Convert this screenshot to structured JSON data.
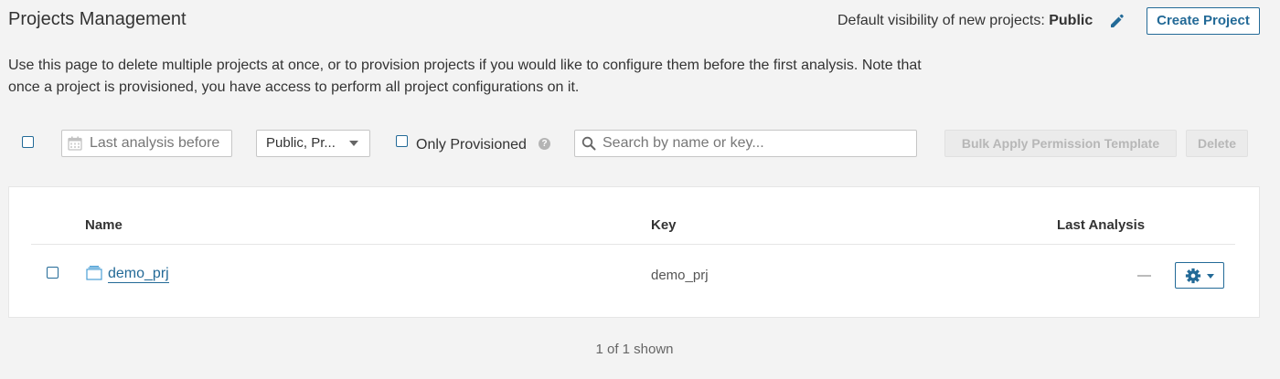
{
  "header": {
    "title": "Projects Management",
    "visibility_label": "Default visibility of new projects:",
    "visibility_value": "Public",
    "create_button": "Create Project"
  },
  "description": "Use this page to delete multiple projects at once, or to provision projects if you would like to configure them before the first analysis. Note that once a project is provisioned, you have access to perform all project configurations on it.",
  "filters": {
    "date_placeholder": "Last analysis before",
    "visibility_select": "Public, Pr...",
    "only_provisioned_label": "Only Provisioned",
    "only_provisioned_checked": false,
    "help_symbol": "?",
    "search_placeholder": "Search by name or key...",
    "bulk_apply_button": "Bulk Apply Permission Template",
    "delete_button": "Delete"
  },
  "table": {
    "columns": [
      "Name",
      "Key",
      "Last Analysis"
    ],
    "rows": [
      {
        "name": "demo_prj",
        "key": "demo_prj",
        "last_analysis": "—",
        "selected": false
      }
    ]
  },
  "footer": {
    "shown_text": "1 of 1 shown"
  },
  "colors": {
    "accent": "#236a97",
    "background": "#f3f3f3",
    "panel": "#ffffff",
    "disabled_text": "#b7b7b7"
  },
  "icons": {
    "edit": "pencil-icon",
    "calendar": "calendar-icon",
    "help": "help-icon",
    "search": "search-icon",
    "project": "project-icon",
    "actions": "gear-icon"
  }
}
